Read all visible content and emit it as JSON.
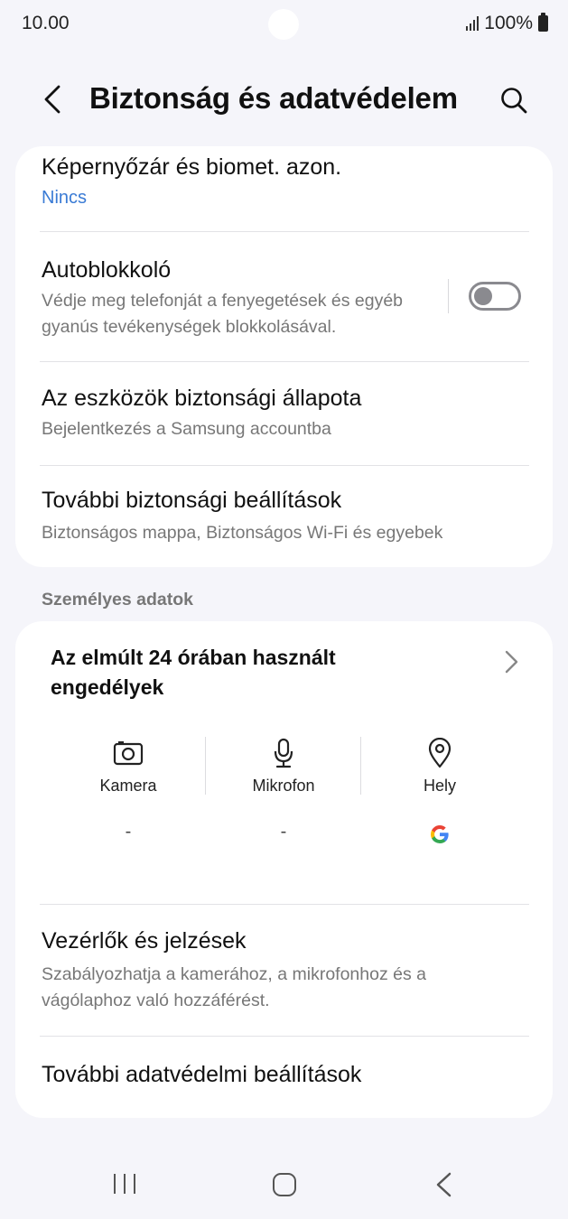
{
  "status": {
    "time": "10.00",
    "battery": "100%"
  },
  "header": {
    "title": "Biztonság és adatvédelem",
    "back_icon": "chevron-left-icon",
    "search_icon": "search-icon"
  },
  "security": {
    "items": [
      {
        "title": "Képernyőzár és biomet. azon.",
        "value": "Nincs"
      },
      {
        "title": "Autoblokkoló",
        "subtitle": "Védje meg telefonját a fenyegetések és egyéb gyanús tevékenységek blokkolásával.",
        "toggle_on": false
      },
      {
        "title": "Az eszközök biztonsági állapota",
        "subtitle": "Bejelentkezés a Samsung accountba"
      },
      {
        "title": "További biztonsági beállítások",
        "subtitle": "Biztonságos mappa, Biztonságos Wi-Fi és egyebek"
      }
    ]
  },
  "privacy": {
    "section_label": "Személyes adatok",
    "permissions_title": "Az elmúlt 24 órában használt engedélyek",
    "permissions": [
      {
        "label": "Kamera",
        "icon": "camera-icon",
        "value": "-"
      },
      {
        "label": "Mikrofon",
        "icon": "microphone-icon",
        "value": "-"
      },
      {
        "label": "Hely",
        "icon": "location-icon",
        "value": "google-icon"
      }
    ],
    "items": [
      {
        "title": "Vezérlők és jelzések",
        "subtitle": "Szabályozhatja a kamerához, a mikrofonhoz és a vágólaphoz való hozzáférést."
      },
      {
        "title": "További adatvédelmi beállítások"
      }
    ]
  },
  "colors": {
    "accent": "#3a7bd5",
    "background": "#f5f5fa",
    "card": "#ffffff"
  }
}
